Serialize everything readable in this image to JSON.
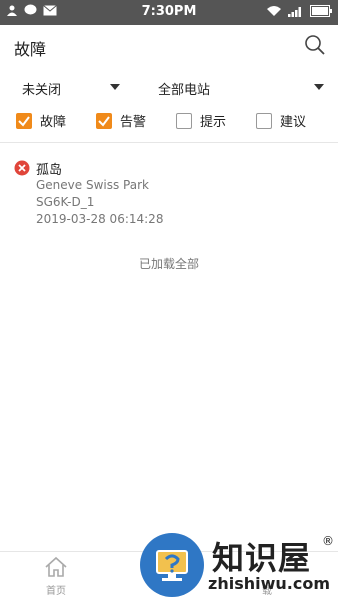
{
  "status_bar": {
    "time": "7:30PM"
  },
  "header": {
    "title": "故障"
  },
  "filters": {
    "status_select": "未关闭",
    "station_select": "全部电站"
  },
  "checkboxes": [
    {
      "label": "故障",
      "checked": true
    },
    {
      "label": "告警",
      "checked": true
    },
    {
      "label": "提示",
      "checked": false
    },
    {
      "label": "建议",
      "checked": false
    }
  ],
  "faults": [
    {
      "name": "孤岛",
      "station": "Geneve Swiss Park",
      "device": "SG6K-D_1",
      "time": "2019-03-28 06:14:28"
    }
  ],
  "list_footer": "已加载全部",
  "bottom_nav": {
    "home_label": "首页",
    "partial_label": "载"
  },
  "watermark": {
    "brand": "知识屋",
    "reg": "®",
    "domain": "zhishiwu.com"
  },
  "colors": {
    "accent": "#f08a1a",
    "error": "#e0453a",
    "watermark_blue": "#2f77c5"
  }
}
